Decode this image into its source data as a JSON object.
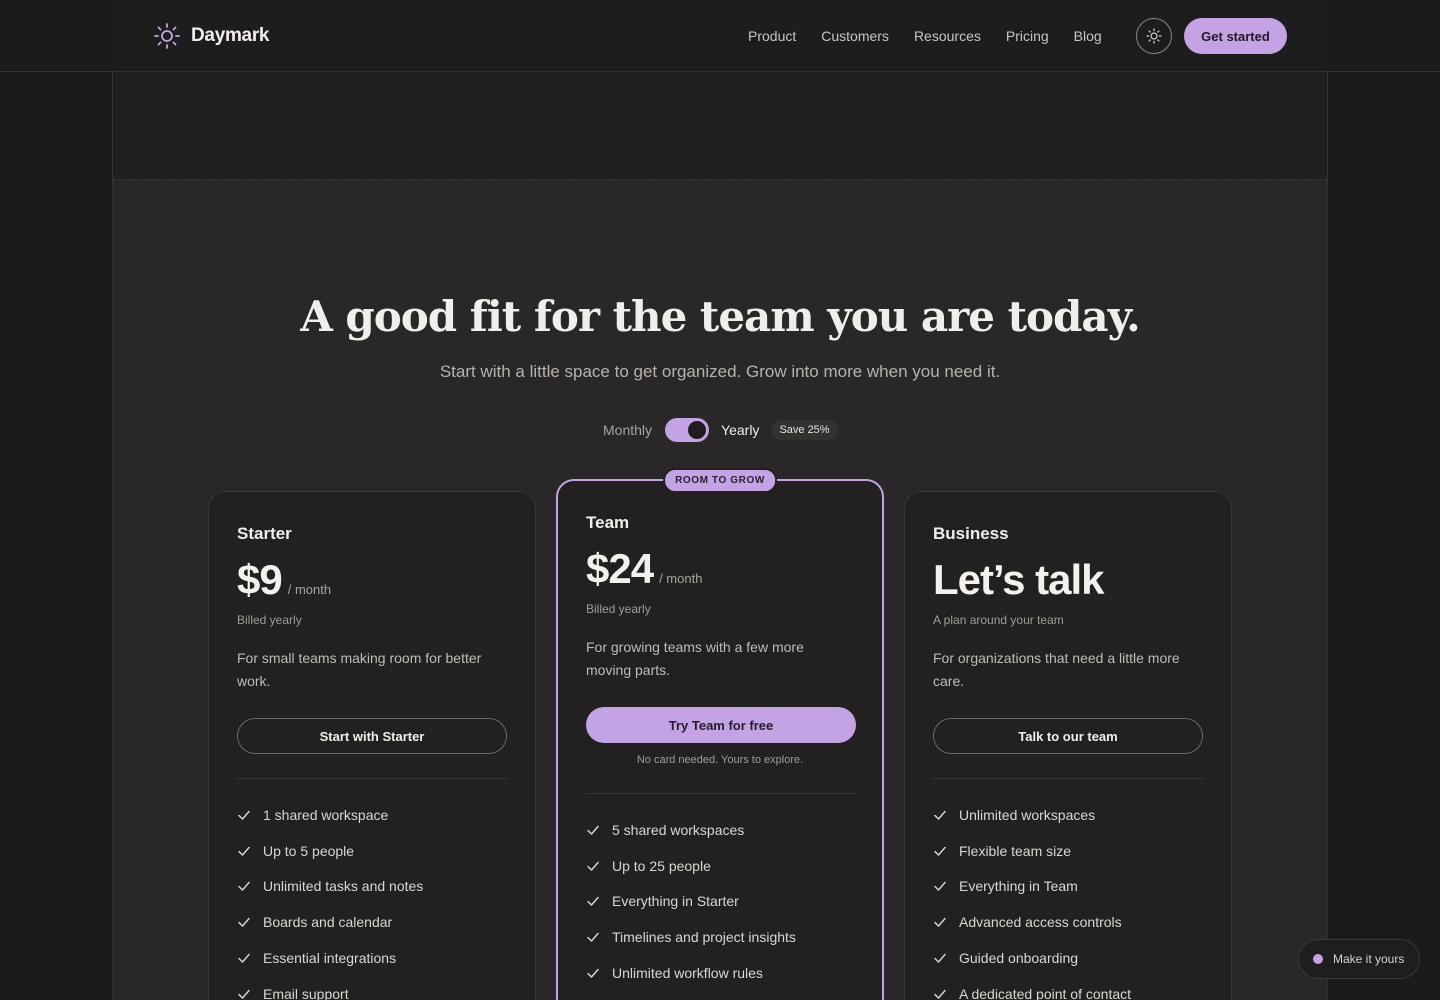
{
  "brand": {
    "name": "Daymark",
    "logo_icon": "sun-icon"
  },
  "nav": {
    "items": [
      "Product",
      "Customers",
      "Resources",
      "Pricing",
      "Blog"
    ],
    "theme_icon": "sun-icon",
    "cta_label": "Get started"
  },
  "hero": {
    "title": "A good fit for the team you are today.",
    "subtitle": "Start with a little space to get organized. Grow into more when you need it."
  },
  "billing": {
    "monthly_label": "Monthly",
    "yearly_label": "Yearly",
    "save_badge": "Save 25%",
    "selected": "Yearly"
  },
  "plans": [
    {
      "name": "Starter",
      "price": "$9",
      "per": "/ month",
      "billed": "Billed yearly",
      "description": "For small teams making room for better work.",
      "button": "Start with Starter",
      "features": [
        "1 shared workspace",
        "Up to 5 people",
        "Unlimited tasks and notes",
        "Boards and calendar",
        "Essential integrations",
        "Email support"
      ]
    },
    {
      "name": "Team",
      "badge": "ROOM TO GROW",
      "price": "$24",
      "per": "/ month",
      "billed": "Billed yearly",
      "description": "For growing teams with a few more moving parts.",
      "button": "Try Team for free",
      "note": "No card needed. Yours to explore.",
      "features": [
        "5 shared workspaces",
        "Up to 25 people",
        "Everything in Starter",
        "Timelines and project insights",
        "Unlimited workflow rules"
      ]
    },
    {
      "name": "Business",
      "price": "Let’s talk",
      "billed": "A plan around your team",
      "description": "For organizations that need a little more care.",
      "button": "Talk to our team",
      "features": [
        "Unlimited workspaces",
        "Flexible team size",
        "Everything in Team",
        "Advanced access controls",
        "Guided onboarding",
        "A dedicated point of contact"
      ]
    }
  ],
  "floating": {
    "label": "Make it yours"
  },
  "colors": {
    "accent": "#c3a3e4",
    "background": "#1c1b1b"
  }
}
